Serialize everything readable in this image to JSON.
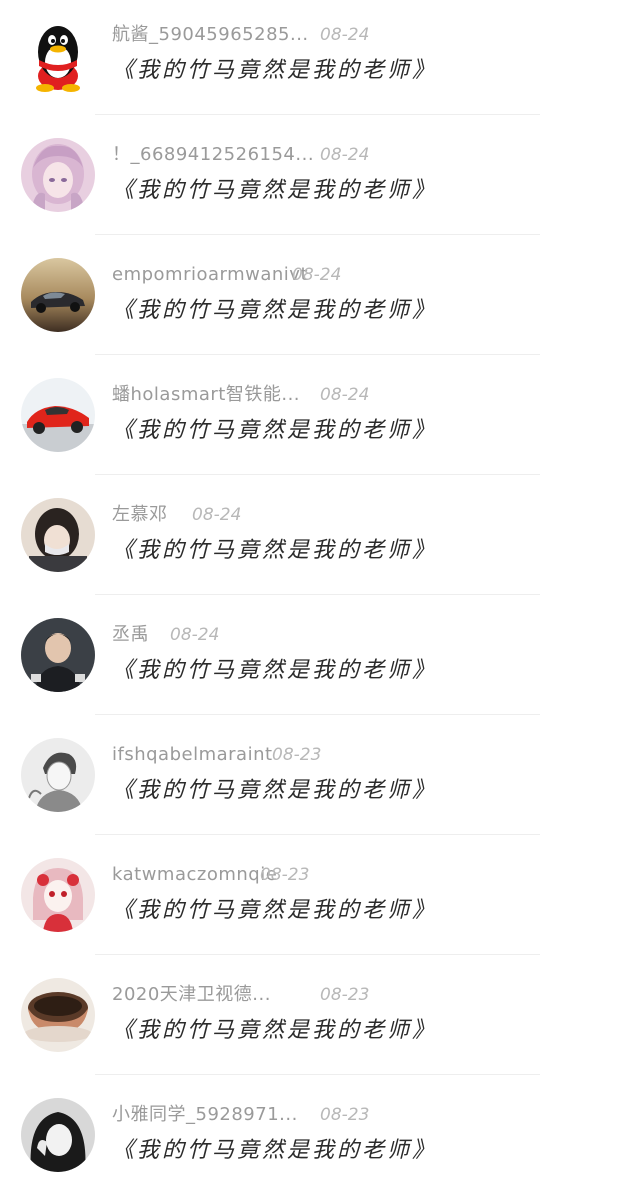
{
  "comments": [
    {
      "username": "航酱_59045965285...",
      "time": "08-24",
      "text": "《我的竹马竟然是我的老师》",
      "avatar_icon": "qq-penguin-icon"
    },
    {
      "username": "！_6689412526154...",
      "time": "08-24",
      "text": "《我的竹马竟然是我的老师》",
      "avatar_icon": "anime-girl-avatar-icon"
    },
    {
      "username": "empomrioarmwanivt",
      "time": "08-24",
      "text": "《我的竹马竟然是我的老师》",
      "avatar_icon": "car-sunset-avatar-icon"
    },
    {
      "username": "蟠holasmart智铁能...",
      "time": "08-24",
      "text": "《我的竹马竟然是我的老师》",
      "avatar_icon": "red-sports-car-avatar-icon"
    },
    {
      "username": "左慕邓",
      "time": "08-24",
      "text": "《我的竹马竟然是我的老师》",
      "avatar_icon": "masked-girl-avatar-icon"
    },
    {
      "username": "丞禹",
      "time": "08-24",
      "text": "《我的竹马竟然是我的老师》",
      "avatar_icon": "young-man-avatar-icon"
    },
    {
      "username": "ifshqabelmaraint",
      "time": "08-23",
      "text": "《我的竹马竟然是我的老师》",
      "avatar_icon": "sketch-boy-avatar-icon"
    },
    {
      "username": "katwmaczomnqie",
      "time": "08-23",
      "text": "《我的竹马竟然是我的老师》",
      "avatar_icon": "doll-girl-avatar-icon"
    },
    {
      "username": "2020天津卫视德...",
      "time": "08-23",
      "text": "《我的竹马竟然是我的老师》",
      "avatar_icon": "teacup-avatar-icon"
    },
    {
      "username": "小雅同学_5928971...",
      "time": "08-23",
      "text": "《我的竹马竟然是我的老师》",
      "avatar_icon": "selfie-girl-avatar-icon"
    }
  ]
}
